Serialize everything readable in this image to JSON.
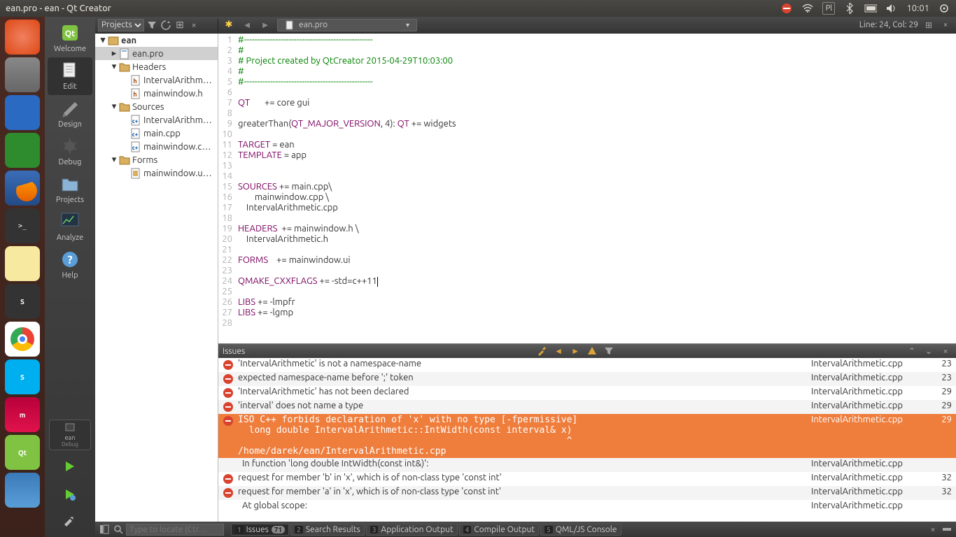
{
  "menubar": {
    "title": "ean.pro - ean - Qt Creator",
    "lang": "Pl",
    "time": "10:01"
  },
  "launcher": [
    {
      "name": "ubuntu-dash",
      "cls": "ubuntu"
    },
    {
      "name": "files",
      "cls": "files"
    },
    {
      "name": "libreoffice-writer",
      "cls": "doc"
    },
    {
      "name": "libreoffice-calc",
      "cls": "sheet"
    },
    {
      "name": "firefox",
      "cls": "ff"
    },
    {
      "name": "terminal",
      "cls": "term",
      "txt": ">_"
    },
    {
      "name": "text-editor",
      "cls": "note"
    },
    {
      "name": "sublime",
      "cls": "subl",
      "txt": "S"
    },
    {
      "name": "chrome",
      "cls": "chrome"
    },
    {
      "name": "skype",
      "cls": "sky",
      "txt": "S"
    },
    {
      "name": "miktex",
      "cls": "mik",
      "txt": "m"
    },
    {
      "name": "qtcreator",
      "cls": "qt",
      "txt": "Qt"
    },
    {
      "name": "gravit",
      "cls": "grv"
    }
  ],
  "modes": [
    {
      "name": "Welcome",
      "id": "welcome"
    },
    {
      "name": "Edit",
      "id": "edit",
      "selected": true
    },
    {
      "name": "Design",
      "id": "design"
    },
    {
      "name": "Debug",
      "id": "debug"
    },
    {
      "name": "Projects",
      "id": "projects"
    },
    {
      "name": "Analyze",
      "id": "analyze"
    },
    {
      "name": "Help",
      "id": "help"
    }
  ],
  "kit": {
    "name": "ean",
    "config": "Debug"
  },
  "sidebar": {
    "selector": "Projects",
    "tree": [
      {
        "depth": 0,
        "open": true,
        "icon": "proj",
        "label": "ean",
        "bold": true
      },
      {
        "depth": 1,
        "open": false,
        "icon": "pro",
        "label": "ean.pro",
        "selected": true
      },
      {
        "depth": 1,
        "open": true,
        "icon": "fld",
        "label": "Headers"
      },
      {
        "depth": 2,
        "icon": "h",
        "label": "IntervalArithm…"
      },
      {
        "depth": 2,
        "icon": "h",
        "label": "mainwindow.h"
      },
      {
        "depth": 1,
        "open": true,
        "icon": "fld",
        "label": "Sources"
      },
      {
        "depth": 2,
        "icon": "c",
        "label": "IntervalArithm…"
      },
      {
        "depth": 2,
        "icon": "c",
        "label": "main.cpp"
      },
      {
        "depth": 2,
        "icon": "c",
        "label": "mainwindow.c…"
      },
      {
        "depth": 1,
        "open": true,
        "icon": "fld",
        "label": "Forms"
      },
      {
        "depth": 2,
        "icon": "ui",
        "label": "mainwindow.u…"
      }
    ]
  },
  "editor": {
    "file": "ean.pro",
    "line_col": "Line: 24, Col: 29",
    "lines": [
      "#-------------------------------------------------",
      "#",
      "# Project created by QtCreator 2015-04-29T10:03:00",
      "#",
      "#-------------------------------------------------",
      "",
      "QT       += core gui",
      "",
      "greaterThan(QT_MAJOR_VERSION, 4): QT += widgets",
      "",
      "TARGET = ean",
      "TEMPLATE = app",
      "",
      "",
      "SOURCES += main.cpp\\",
      "        mainwindow.cpp \\",
      "    IntervalArithmetic.cpp",
      "",
      "HEADERS  += mainwindow.h \\",
      "    IntervalArithmetic.h",
      "",
      "FORMS    += mainwindow.ui",
      "",
      "QMAKE_CXXFLAGS += -std=c++11",
      "",
      "LIBS += -lmpfr",
      "LIBS += -lgmp",
      ""
    ]
  },
  "issues": {
    "title": "Issues",
    "rows": [
      {
        "err": true,
        "msg": "'IntervalArithmetic' is not a namespace-name",
        "file": "IntervalArithmetic.cpp",
        "ln": "23"
      },
      {
        "err": true,
        "msg": "expected namespace-name before ';' token",
        "file": "IntervalArithmetic.cpp",
        "ln": "23"
      },
      {
        "err": true,
        "msg": "'IntervalArithmetic' has not been declared",
        "file": "IntervalArithmetic.cpp",
        "ln": "29"
      },
      {
        "err": true,
        "msg": "'interval' does not name a type",
        "file": "IntervalArithmetic.cpp",
        "ln": "29"
      },
      {
        "err": true,
        "msg": "ISO C++ forbids declaration of 'x' with no type [-fpermissive]\n  long double IntervalArithmetic::IntWidth(const interval& x)\n                                                            ^\n/home/darek/ean/IntervalArithmetic.cpp",
        "file": "IntervalArithmetic.cpp",
        "ln": "29",
        "selected": true
      },
      {
        "err": false,
        "msg": "  In function 'long double IntWidth(const int&)':",
        "file": "IntervalArithmetic.cpp",
        "ln": ""
      },
      {
        "err": true,
        "msg": "request for member 'b' in 'x', which is of non-class type 'const int'",
        "file": "IntervalArithmetic.cpp",
        "ln": "32"
      },
      {
        "err": true,
        "msg": "request for member 'a' in 'x', which is of non-class type 'const int'",
        "file": "IntervalArithmetic.cpp",
        "ln": "32"
      },
      {
        "err": false,
        "msg": "  At global scope:",
        "file": "IntervalArithmetic.cpp",
        "ln": ""
      }
    ]
  },
  "bottombar": {
    "search_placeholder": "Type to locate (Ctr…",
    "tabs": [
      {
        "n": "1",
        "label": "Issues",
        "badge": "71",
        "active": true
      },
      {
        "n": "2",
        "label": "Search Results"
      },
      {
        "n": "3",
        "label": "Application Output"
      },
      {
        "n": "4",
        "label": "Compile Output"
      },
      {
        "n": "5",
        "label": "QML/JS Console"
      }
    ]
  }
}
